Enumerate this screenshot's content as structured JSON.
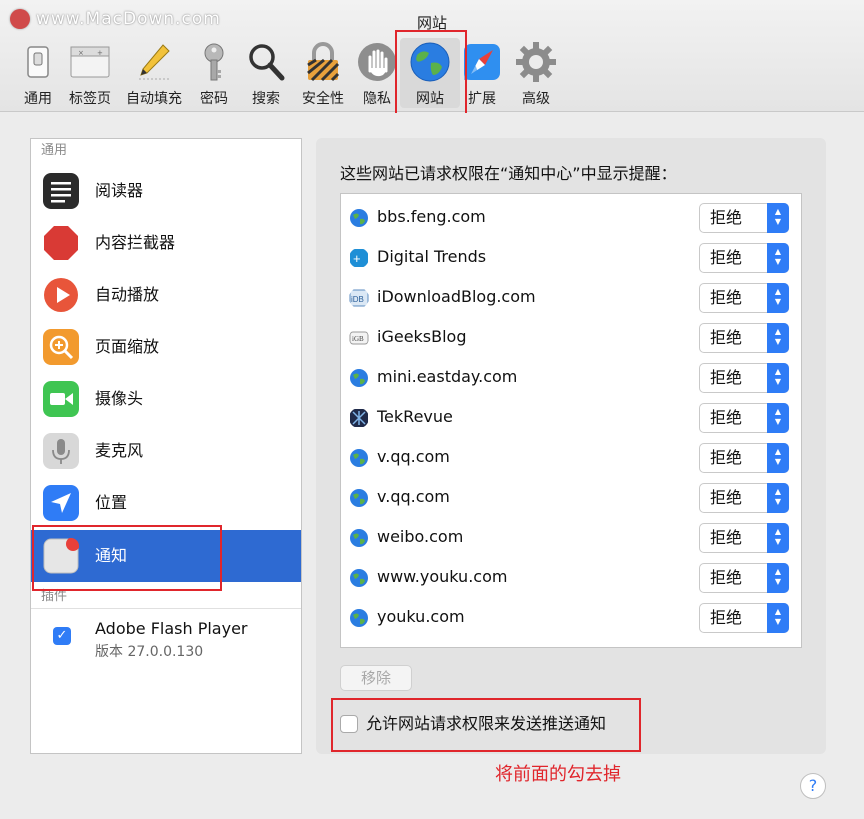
{
  "window": {
    "title": "网站",
    "watermark": "www.MacDown.com"
  },
  "toolbar": {
    "items": [
      {
        "label": "通用",
        "icon": "switch-icon"
      },
      {
        "label": "标签页",
        "icon": "tabs-icon"
      },
      {
        "label": "自动填充",
        "icon": "pencil-icon"
      },
      {
        "label": "密码",
        "icon": "key-icon"
      },
      {
        "label": "搜索",
        "icon": "magnifier-icon"
      },
      {
        "label": "安全性",
        "icon": "lock-icon"
      },
      {
        "label": "隐私",
        "icon": "hand-icon"
      },
      {
        "label": "网站",
        "icon": "globe-icon",
        "selected": true
      },
      {
        "label": "扩展",
        "icon": "compass-icon"
      },
      {
        "label": "高级",
        "icon": "gear-icon"
      }
    ]
  },
  "sidebar": {
    "section_general": "通用",
    "items": [
      {
        "label": "阅读器",
        "icon": "reader-icon"
      },
      {
        "label": "内容拦截器",
        "icon": "stop-icon"
      },
      {
        "label": "自动播放",
        "icon": "play-icon"
      },
      {
        "label": "页面缩放",
        "icon": "zoom-icon"
      },
      {
        "label": "摄像头",
        "icon": "camera-icon"
      },
      {
        "label": "麦克风",
        "icon": "microphone-icon"
      },
      {
        "label": "位置",
        "icon": "location-icon"
      },
      {
        "label": "通知",
        "icon": "notification-icon",
        "selected": true
      }
    ],
    "section_plugins": "插件",
    "plugin": {
      "name": "Adobe Flash Player",
      "version": "版本 27.0.0.130",
      "enabled": true
    }
  },
  "panel": {
    "title": "这些网站已请求权限在“通知中心”中显示提醒：",
    "sites": [
      {
        "name": "bbs.feng.com",
        "permission": "拒绝",
        "icon": "globe-icon"
      },
      {
        "name": "Digital Trends",
        "permission": "拒绝",
        "icon": "digital-trends-icon"
      },
      {
        "name": "iDownloadBlog.com",
        "permission": "拒绝",
        "icon": "idb-icon"
      },
      {
        "name": "iGeeksBlog",
        "permission": "拒绝",
        "icon": "igb-icon"
      },
      {
        "name": "mini.eastday.com",
        "permission": "拒绝",
        "icon": "globe-icon"
      },
      {
        "name": "TekRevue",
        "permission": "拒绝",
        "icon": "tekrevue-icon"
      },
      {
        "name": "v.qq.com",
        "permission": "拒绝",
        "icon": "globe-icon"
      },
      {
        "name": "v.qq.com",
        "permission": "拒绝",
        "icon": "globe-icon"
      },
      {
        "name": "weibo.com",
        "permission": "拒绝",
        "icon": "globe-icon"
      },
      {
        "name": "www.youku.com",
        "permission": "拒绝",
        "icon": "globe-icon"
      },
      {
        "name": "youku.com",
        "permission": "拒绝",
        "icon": "globe-icon"
      }
    ],
    "remove_label": "移除",
    "allow_label": "允许网站请求权限来发送推送通知",
    "allow_checked": false
  },
  "annotation": {
    "text": "将前面的勾去掉",
    "color": "#e0262c"
  },
  "help": "?",
  "colors": {
    "accent": "#2e6ad2",
    "highlight": "#e0262c"
  }
}
